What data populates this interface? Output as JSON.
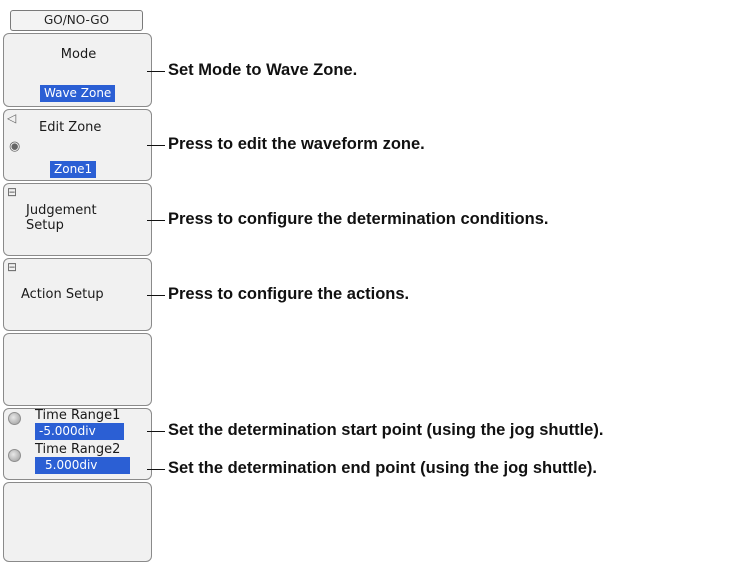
{
  "panel_title": "GO/NO-GO",
  "menu": {
    "mode": {
      "label": "Mode",
      "value": "Wave Zone"
    },
    "edit_zone": {
      "label": "Edit Zone",
      "value": "Zone1",
      "arrow_icon": "left-arrow-icon",
      "jog_icon": "jog-shuttle-icon"
    },
    "judgement_setup": {
      "label_line1": "Judgement",
      "label_line2": "Setup",
      "icon": "submenu-icon"
    },
    "action_setup": {
      "label": "Action Setup",
      "icon": "submenu-icon"
    },
    "time_range": {
      "range1_label": "Time Range1",
      "range1_value": "-5.000div",
      "range2_label": "Time Range2",
      "range2_value": "5.000div"
    }
  },
  "callouts": {
    "mode": "Set Mode to Wave Zone.",
    "edit_zone": "Press to edit the waveform zone.",
    "judgement_setup": "Press to configure the determination conditions.",
    "action_setup": "Press to configure the actions.",
    "time_range1": "Set the determination start point (using the jog shuttle).",
    "time_range2": "Set the determination end point (using the jog shuttle)."
  },
  "colors": {
    "highlight": "#2b5fd4",
    "key_bg": "#f1f1f1",
    "key_border": "#8a8a8a"
  }
}
